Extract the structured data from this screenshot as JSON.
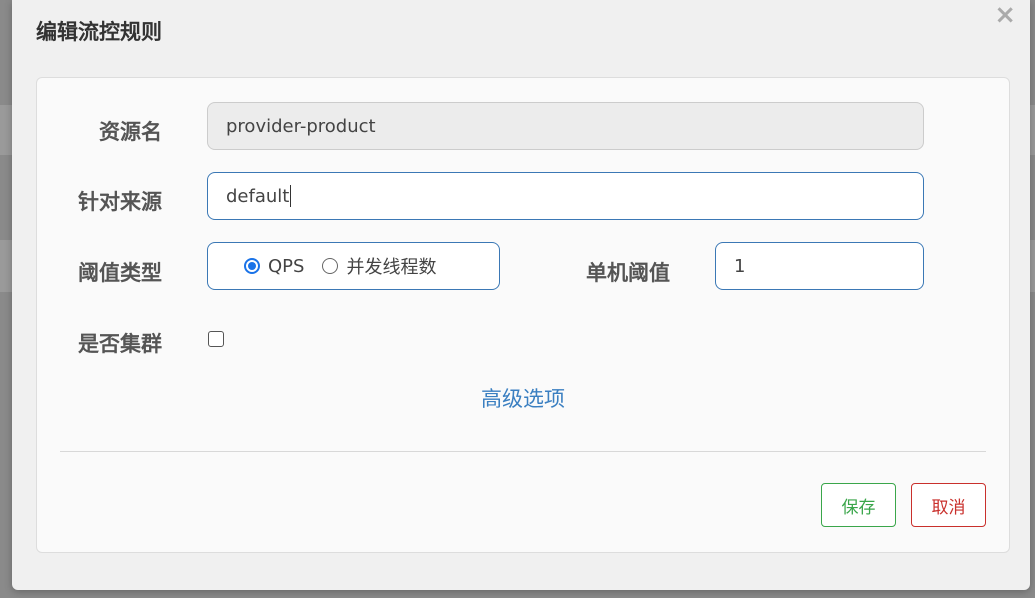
{
  "dialog": {
    "title": "编辑流控规则",
    "close_icon": "×"
  },
  "form": {
    "resource_name": {
      "label": "资源名",
      "value": "provider-product"
    },
    "limit_app": {
      "label": "针对来源",
      "value": "default"
    },
    "threshold_type": {
      "label": "阈值类型",
      "options": [
        {
          "label": "QPS",
          "checked": true
        },
        {
          "label": "并发线程数",
          "checked": false
        }
      ]
    },
    "single_threshold": {
      "label": "单机阈值",
      "value": "1"
    },
    "cluster_mode": {
      "label": "是否集群",
      "checked": false
    },
    "advanced_options": "高级选项"
  },
  "footer": {
    "save_label": "保存",
    "cancel_label": "取消"
  },
  "colors": {
    "link": "#3a7fc1",
    "save": "#3aa64a",
    "cancel": "#c9302c",
    "radio_checked": "#1a73e8"
  }
}
